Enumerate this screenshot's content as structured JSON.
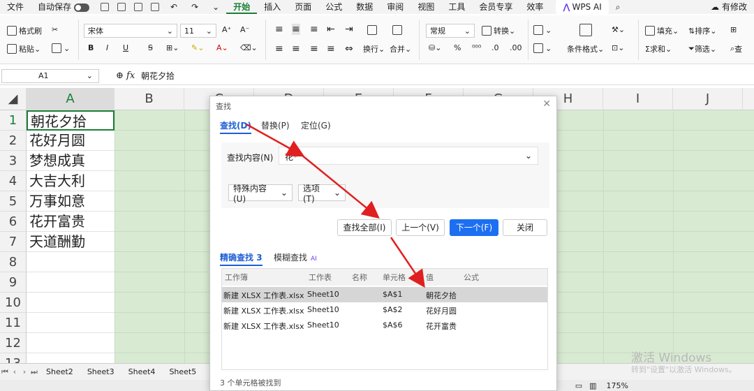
{
  "menubar": {
    "file": "文件",
    "autosave": "自动保存",
    "tabs": [
      "开始",
      "插入",
      "页面",
      "公式",
      "数据",
      "审阅",
      "视图",
      "工具",
      "会员专享",
      "效率"
    ],
    "active_tab": "开始",
    "wps_ai": "WPS AI",
    "modify": "有修改"
  },
  "ribbon": {
    "format_painter": "格式刷",
    "paste": "粘贴",
    "font_name": "宋体",
    "font_size": "11",
    "bold": "B",
    "italic": "I",
    "underline": "U",
    "number_format": "常规",
    "convert": "转换",
    "wrap": "换行",
    "merge": "合并",
    "conditional_format": "条件格式",
    "fill": "填充",
    "sort": "排序",
    "sum": "求和",
    "filter": "筛选",
    "find": "查"
  },
  "formula_bar": {
    "name_box": "A1",
    "fx": "fx",
    "content": "朝花夕拾"
  },
  "sheet": {
    "columns": [
      "A",
      "B",
      "C",
      "D",
      "E",
      "F",
      "G",
      "H",
      "I",
      "J"
    ],
    "rows": [
      "1",
      "2",
      "3",
      "4",
      "5",
      "6",
      "7",
      "8",
      "9",
      "10",
      "11",
      "12",
      "13"
    ],
    "colA_values": [
      "朝花夕拾",
      "花好月圆",
      "梦想成真",
      "大吉大利",
      "万事如意",
      "花开富贵",
      "天道酬勤"
    ],
    "tabs": [
      "Sheet2",
      "Sheet3",
      "Sheet4",
      "Sheet5"
    ]
  },
  "status": {
    "zoom": "175%",
    "watermark_line1": "激活 Windows",
    "watermark_line2": "转到\"设置\"以激活 Windows。"
  },
  "dialog": {
    "title": "查找",
    "tabs": [
      "查找(D)",
      "替换(P)",
      "定位(G)"
    ],
    "find_label": "查找内容(N)",
    "find_value": "花*",
    "special_content": "特殊内容(U)",
    "options": "选项(T)",
    "btn_find_all": "查找全部(I)",
    "btn_prev": "上一个(V)",
    "btn_next": "下一个(F)",
    "btn_close": "关闭",
    "result_tabs": {
      "exact": "精确查找",
      "exact_count": "3",
      "fuzzy": "模糊查找",
      "ai": "AI"
    },
    "result_headers": [
      "工作簿",
      "工作表",
      "名称",
      "单元格",
      "值",
      "公式"
    ],
    "results": [
      {
        "workbook": "新建 XLSX 工作表.xlsx",
        "sheet": "Sheet10",
        "name": "",
        "cell": "$A$1",
        "value": "朝花夕拾",
        "formula": ""
      },
      {
        "workbook": "新建 XLSX 工作表.xlsx",
        "sheet": "Sheet10",
        "name": "",
        "cell": "$A$2",
        "value": "花好月圆",
        "formula": ""
      },
      {
        "workbook": "新建 XLSX 工作表.xlsx",
        "sheet": "Sheet10",
        "name": "",
        "cell": "$A$6",
        "value": "花开富贵",
        "formula": ""
      }
    ],
    "status": "3 个单元格被找到"
  },
  "colors": {
    "accent_green": "#1a7f37",
    "primary_blue": "#1d6ff2",
    "arrow_red": "#e02020",
    "grid_bg": "#d9ead3"
  }
}
